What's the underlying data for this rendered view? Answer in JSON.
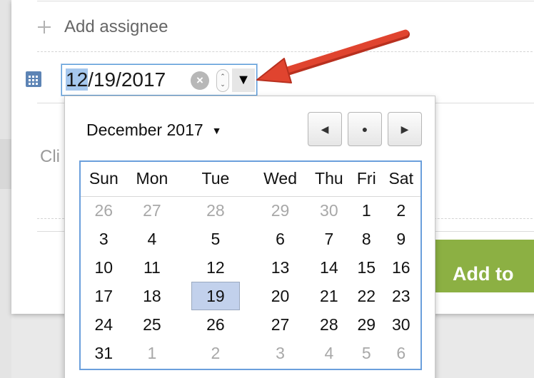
{
  "assignee": {
    "label": "Add assignee"
  },
  "background": {
    "click_text": "Cli"
  },
  "add_button": {
    "label": "Add to"
  },
  "date_field": {
    "value_selected_part": "12",
    "value_rest": "/19/2017",
    "clear_glyph": "×",
    "spin_glyph_up": "⌃",
    "spin_glyph_down": "⌄",
    "dropdown_glyph": "▼"
  },
  "calendar": {
    "month_label": "December 2017",
    "month_caret": "▼",
    "nav": {
      "prev": "◀",
      "today": "●",
      "next": "▶"
    },
    "weekdays": [
      "Sun",
      "Mon",
      "Tue",
      "Wed",
      "Thu",
      "Fri",
      "Sat"
    ],
    "weeks": [
      [
        {
          "d": "26",
          "other": true
        },
        {
          "d": "27",
          "other": true
        },
        {
          "d": "28",
          "other": true
        },
        {
          "d": "29",
          "other": true
        },
        {
          "d": "30",
          "other": true
        },
        {
          "d": "1"
        },
        {
          "d": "2"
        }
      ],
      [
        {
          "d": "3"
        },
        {
          "d": "4"
        },
        {
          "d": "5"
        },
        {
          "d": "6"
        },
        {
          "d": "7"
        },
        {
          "d": "8"
        },
        {
          "d": "9"
        }
      ],
      [
        {
          "d": "10"
        },
        {
          "d": "11"
        },
        {
          "d": "12"
        },
        {
          "d": "13"
        },
        {
          "d": "14"
        },
        {
          "d": "15"
        },
        {
          "d": "16"
        }
      ],
      [
        {
          "d": "17"
        },
        {
          "d": "18"
        },
        {
          "d": "19",
          "selected": true
        },
        {
          "d": "20"
        },
        {
          "d": "21"
        },
        {
          "d": "22"
        },
        {
          "d": "23"
        }
      ],
      [
        {
          "d": "24"
        },
        {
          "d": "25"
        },
        {
          "d": "26"
        },
        {
          "d": "27"
        },
        {
          "d": "28"
        },
        {
          "d": "29"
        },
        {
          "d": "30"
        }
      ],
      [
        {
          "d": "31"
        },
        {
          "d": "1",
          "other": true
        },
        {
          "d": "2",
          "other": true
        },
        {
          "d": "3",
          "other": true
        },
        {
          "d": "4",
          "other": true
        },
        {
          "d": "5",
          "other": true
        },
        {
          "d": "6",
          "other": true
        }
      ]
    ]
  },
  "colors": {
    "accent_blue": "#5b9dd9",
    "selected_day": "#c2d1ec",
    "add_button_green": "#8cb043",
    "arrow_red": "#e0442f"
  },
  "icons": {
    "plus": "plus-icon",
    "calendar": "calendar-icon",
    "arrow": "red-arrow-annotation"
  }
}
